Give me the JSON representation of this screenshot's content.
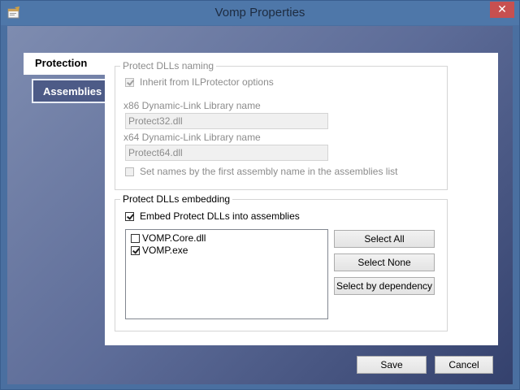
{
  "window": {
    "title": "Vomp Properties",
    "close_symbol": "✕"
  },
  "tabs": [
    {
      "label": "Protection"
    },
    {
      "label": "Assemblies"
    }
  ],
  "naming": {
    "legend": "Protect DLLs naming",
    "inherit_label": "Inherit from ILProtector options",
    "inherit_checked": true,
    "x86_label": "x86 Dynamic-Link Library name",
    "x86_value": "Protect32.dll",
    "x64_label": "x64 Dynamic-Link Library name",
    "x64_value": "Protect64.dll",
    "setnames_label": "Set names by the first assembly name in the assemblies list",
    "setnames_checked": false
  },
  "embedding": {
    "legend": "Protect DLLs embedding",
    "embed_label": "Embed Protect DLLs into assemblies",
    "embed_checked": true,
    "items": [
      {
        "label": "VOMP.Core.dll",
        "checked": false
      },
      {
        "label": "VOMP.exe",
        "checked": true
      }
    ],
    "select_all": "Select All",
    "select_none": "Select None",
    "select_dependency": "Select by dependency"
  },
  "footer": {
    "save": "Save",
    "cancel": "Cancel"
  },
  "colors": {
    "titlebar": "#4e77a9",
    "close": "#c75050",
    "client_dark": "#34416d"
  }
}
